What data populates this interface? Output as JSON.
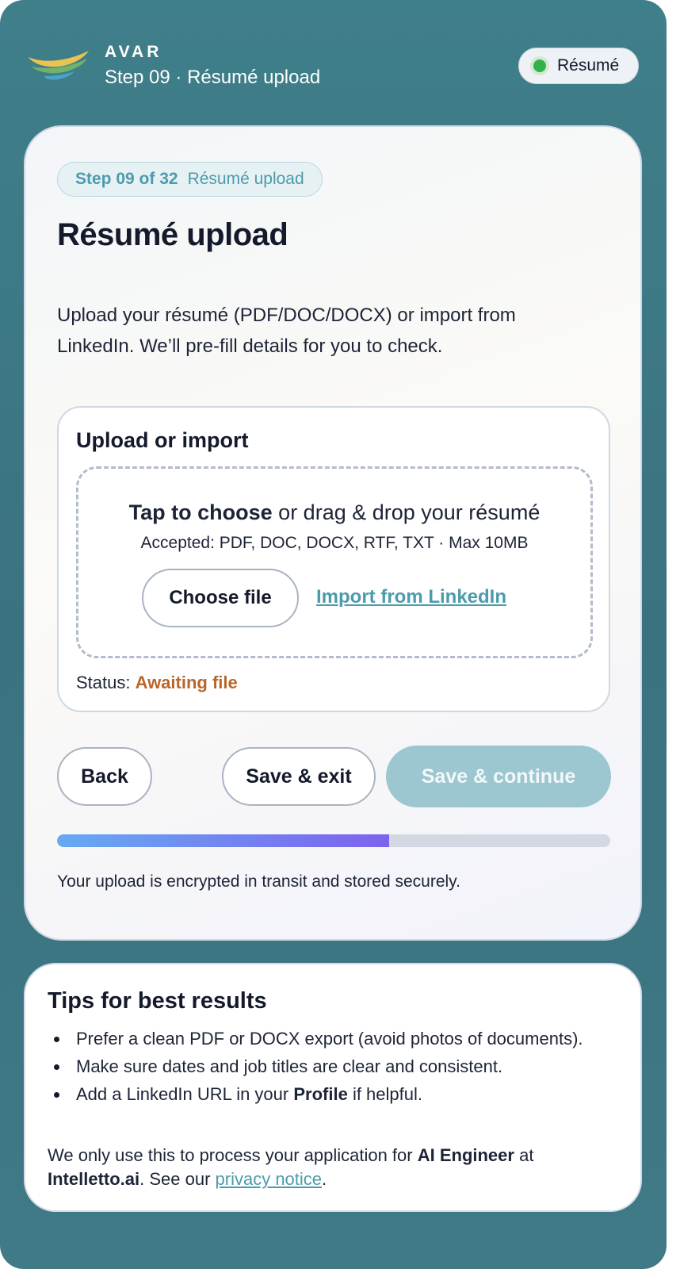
{
  "header": {
    "brand": "AVAR",
    "subtitle": "Step 09 · Résumé upload",
    "status_pill": "Résumé"
  },
  "main": {
    "badge_step": "Step 09 of 32",
    "badge_label": "Résumé upload",
    "title": "Résumé upload",
    "description": "Upload your résumé (PDF/DOC/DOCX) or import from LinkedIn. We’ll pre-fill details for you to check.",
    "upload": {
      "title": "Upload or import",
      "tap_bold": "Tap to choose",
      "tap_rest": " or drag & drop your résumé",
      "accepted": "Accepted: PDF, DOC, DOCX, RTF, TXT · Max 10MB",
      "choose_file": "Choose file",
      "import_linkedin": "Import from LinkedIn",
      "status_label": "Status: ",
      "status_value": "Awaiting file"
    },
    "buttons": {
      "back": "Back",
      "save_exit": "Save & exit",
      "save_continue": "Save & continue"
    },
    "progress_fraction": 0.6,
    "secure_note": "Your upload is encrypted in transit and stored securely."
  },
  "tips": {
    "title": "Tips for best results",
    "item1": "Prefer a clean PDF or DOCX export (avoid photos of documents).",
    "item2": "Make sure dates and job titles are clear and consistent.",
    "item3_pre": "Add a LinkedIn URL in your ",
    "item3_bold": "Profile",
    "item3_post": " if helpful.",
    "note_pre": "We only use this to process your application for ",
    "note_role": "AI Engineer",
    "note_mid": " at ",
    "note_company": "Intelletto.ai",
    "note_see": ". See our ",
    "note_link": "privacy notice",
    "note_end": "."
  },
  "colors": {
    "accent": "#4c9bac",
    "status_awaiting": "#b8662a",
    "pill_dot": "#34b24a",
    "continue_disabled": "#9cc7d0"
  },
  "icons": {
    "logo": "avar-logo-icon",
    "status_dot": "status-dot-icon"
  }
}
